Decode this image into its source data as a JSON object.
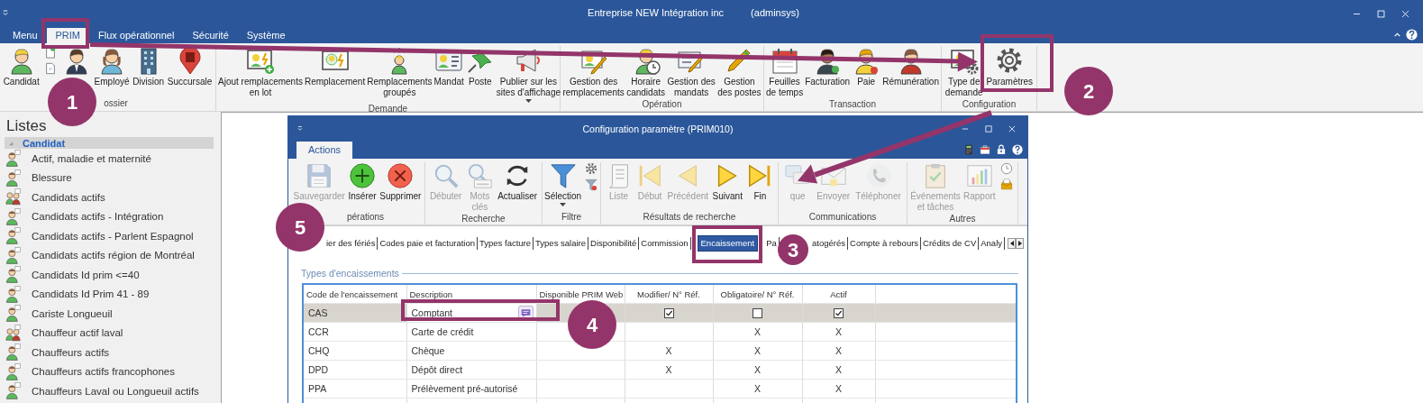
{
  "window": {
    "title": "Entreprise NEW Intégration inc",
    "user": "(adminsys)"
  },
  "menu_tabs": [
    {
      "label": "Menu",
      "selected": false
    },
    {
      "label": "PRIM",
      "selected": true
    },
    {
      "label": "Flux opérationnel",
      "selected": false
    },
    {
      "label": "Sécurité",
      "selected": false
    },
    {
      "label": "Système",
      "selected": false
    }
  ],
  "ribbon": {
    "groups": [
      {
        "label": "ossier",
        "buttons": [
          {
            "kind": "large",
            "label": "Candidat"
          },
          {
            "kind": "stack"
          },
          {
            "kind": "icon"
          },
          {
            "kind": "large",
            "label": "Employé"
          },
          {
            "kind": "large",
            "label": "Division"
          },
          {
            "kind": "large",
            "label": "Succursale"
          }
        ]
      },
      {
        "label": "Demande",
        "buttons": [
          {
            "kind": "large",
            "label": "Ajout remplacements\nen lot"
          },
          {
            "kind": "large",
            "label": "Remplacement"
          },
          {
            "kind": "large",
            "label": "Remplacements\ngroupés"
          },
          {
            "kind": "large",
            "label": "Mandat"
          },
          {
            "kind": "large",
            "label": "Poste"
          },
          {
            "kind": "dropdown",
            "label": "Publier sur les\nsites d'affichage"
          }
        ]
      },
      {
        "label": "Opération",
        "buttons": [
          {
            "kind": "large",
            "label": "Gestion des\nremplacements"
          },
          {
            "kind": "large",
            "label": "Horaire\ncandidats"
          },
          {
            "kind": "large",
            "label": "Gestion des\nmandats"
          },
          {
            "kind": "large",
            "label": "Gestion\ndes postes"
          }
        ]
      },
      {
        "label": "Transaction",
        "buttons": [
          {
            "kind": "large",
            "label": "Feuilles\nde temps"
          },
          {
            "kind": "large",
            "label": "Facturation"
          },
          {
            "kind": "large",
            "label": "Paie"
          },
          {
            "kind": "large",
            "label": "Rémunération"
          }
        ]
      },
      {
        "label": "Configuration",
        "buttons": [
          {
            "kind": "large",
            "label": "Type de\ndemande"
          },
          {
            "kind": "large",
            "label": "Paramètres"
          }
        ]
      }
    ]
  },
  "sidebar": {
    "title": "Listes",
    "tree": [
      {
        "label": "Candidat",
        "expanded": true,
        "selected": true,
        "children": [
          {
            "label": "Actif, maladie et maternité"
          },
          {
            "label": "Blessure"
          },
          {
            "label": "Candidats actifs"
          },
          {
            "label": "Candidats actifs - Intégration"
          },
          {
            "label": "Candidats actifs - Parlent Espagnol"
          },
          {
            "label": "Candidats actifs région de Montréal"
          },
          {
            "label": "Candidats Id prim <=40"
          },
          {
            "label": "Candidats Id Prim 41 - 89"
          },
          {
            "label": "Cariste Longueuil"
          },
          {
            "label": "Chauffeur actif laval"
          },
          {
            "label": "Chauffeurs actifs"
          },
          {
            "label": "Chauffeurs actifs francophones"
          },
          {
            "label": "Chauffeurs Laval ou Longueuil actifs"
          }
        ]
      }
    ]
  },
  "dialog": {
    "title": "Configuration paramètre (PRIM010)",
    "tabs": [
      {
        "label": "Actions",
        "selected": true
      }
    ],
    "ribbon": {
      "groups": [
        {
          "label": "pérations",
          "buttons": [
            {
              "kind": "large",
              "label": "Sauvegarder",
              "disabled": true
            },
            {
              "kind": "large",
              "label": "Insérer",
              "disabled": false
            },
            {
              "kind": "large",
              "label": "Supprimer",
              "disabled": false
            }
          ]
        },
        {
          "label": "Recherche",
          "buttons": [
            {
              "kind": "large",
              "label": "Débuter",
              "disabled": true
            },
            {
              "kind": "large",
              "label": "Mots\nclés",
              "disabled": true
            },
            {
              "kind": "large",
              "label": "Actualiser",
              "disabled": false
            }
          ]
        },
        {
          "label": "Filtre",
          "buttons": [
            {
              "kind": "dropdown",
              "label": "Sélection",
              "disabled": false
            },
            {
              "kind": "stack"
            }
          ]
        },
        {
          "label": "Résultats de recherche",
          "buttons": [
            {
              "kind": "large",
              "label": "Liste",
              "disabled": true
            },
            {
              "kind": "large",
              "label": "Début",
              "disabled": true
            },
            {
              "kind": "large",
              "label": "Précédent",
              "disabled": true
            },
            {
              "kind": "large",
              "label": "Suivant",
              "disabled": false
            },
            {
              "kind": "large",
              "label": "Fin",
              "disabled": false
            }
          ]
        },
        {
          "label": "Communications",
          "buttons": [
            {
              "kind": "large",
              "label": "que",
              "disabled": true
            },
            {
              "kind": "large",
              "label": "Envoyer",
              "disabled": true
            },
            {
              "kind": "large",
              "label": "Téléphoner",
              "disabled": true
            }
          ]
        },
        {
          "label": "Autres",
          "buttons": [
            {
              "kind": "large",
              "label": "Événements\net tâches",
              "disabled": true
            },
            {
              "kind": "large",
              "label": "Rapport",
              "disabled": true
            },
            {
              "kind": "stack"
            }
          ]
        }
      ]
    },
    "pages": [
      {
        "label": "ier des fériés",
        "selected": false
      },
      {
        "label": "Codes paie et facturation",
        "selected": false
      },
      {
        "label": "Types facture",
        "selected": false
      },
      {
        "label": "Types salaire",
        "selected": false
      },
      {
        "label": "Disponibilité",
        "selected": false
      },
      {
        "label": "Commission",
        "selected": false
      },
      {
        "label": "Encaissement",
        "selected": true
      },
      {
        "label": "Pa",
        "selected": false
      },
      {
        "label": "atogérés",
        "selected": false
      },
      {
        "label": "Compte à rebours",
        "selected": false
      },
      {
        "label": "Crédits de CV",
        "selected": false
      },
      {
        "label": "Analy",
        "selected": false
      }
    ],
    "section": {
      "title": "Types d'encaissements",
      "columns": [
        "Code de l'encaissement",
        "Description",
        "Disponible PRIM Web",
        "Modifier/ N° Réf.",
        "Obligatoire/ N° Réf.",
        "Actif"
      ],
      "rows": [
        {
          "code": "CAS",
          "description": "Comptant",
          "selected": true,
          "editing": true,
          "checks": {
            "modifier_ref": true,
            "obligatoire_ref": false,
            "actif": true
          }
        },
        {
          "code": "CCR",
          "description": "Carte de crédit",
          "selected": false,
          "obligatoire_ref": "X",
          "actif": "X"
        },
        {
          "code": "CHQ",
          "description": "Chèque",
          "selected": false,
          "modifier_ref": "X",
          "obligatoire_ref": "X",
          "actif": "X"
        },
        {
          "code": "DPD",
          "description": "Dépôt direct",
          "selected": false,
          "modifier_ref": "X",
          "obligatoire_ref": "X",
          "actif": "X"
        },
        {
          "code": "PPA",
          "description": "Prélèvement pré-autorisé",
          "selected": false,
          "obligatoire_ref": "X",
          "actif": "X"
        }
      ]
    }
  },
  "callouts": [
    {
      "number": "1"
    },
    {
      "number": "2"
    },
    {
      "number": "3"
    },
    {
      "number": "4"
    },
    {
      "number": "5"
    }
  ]
}
